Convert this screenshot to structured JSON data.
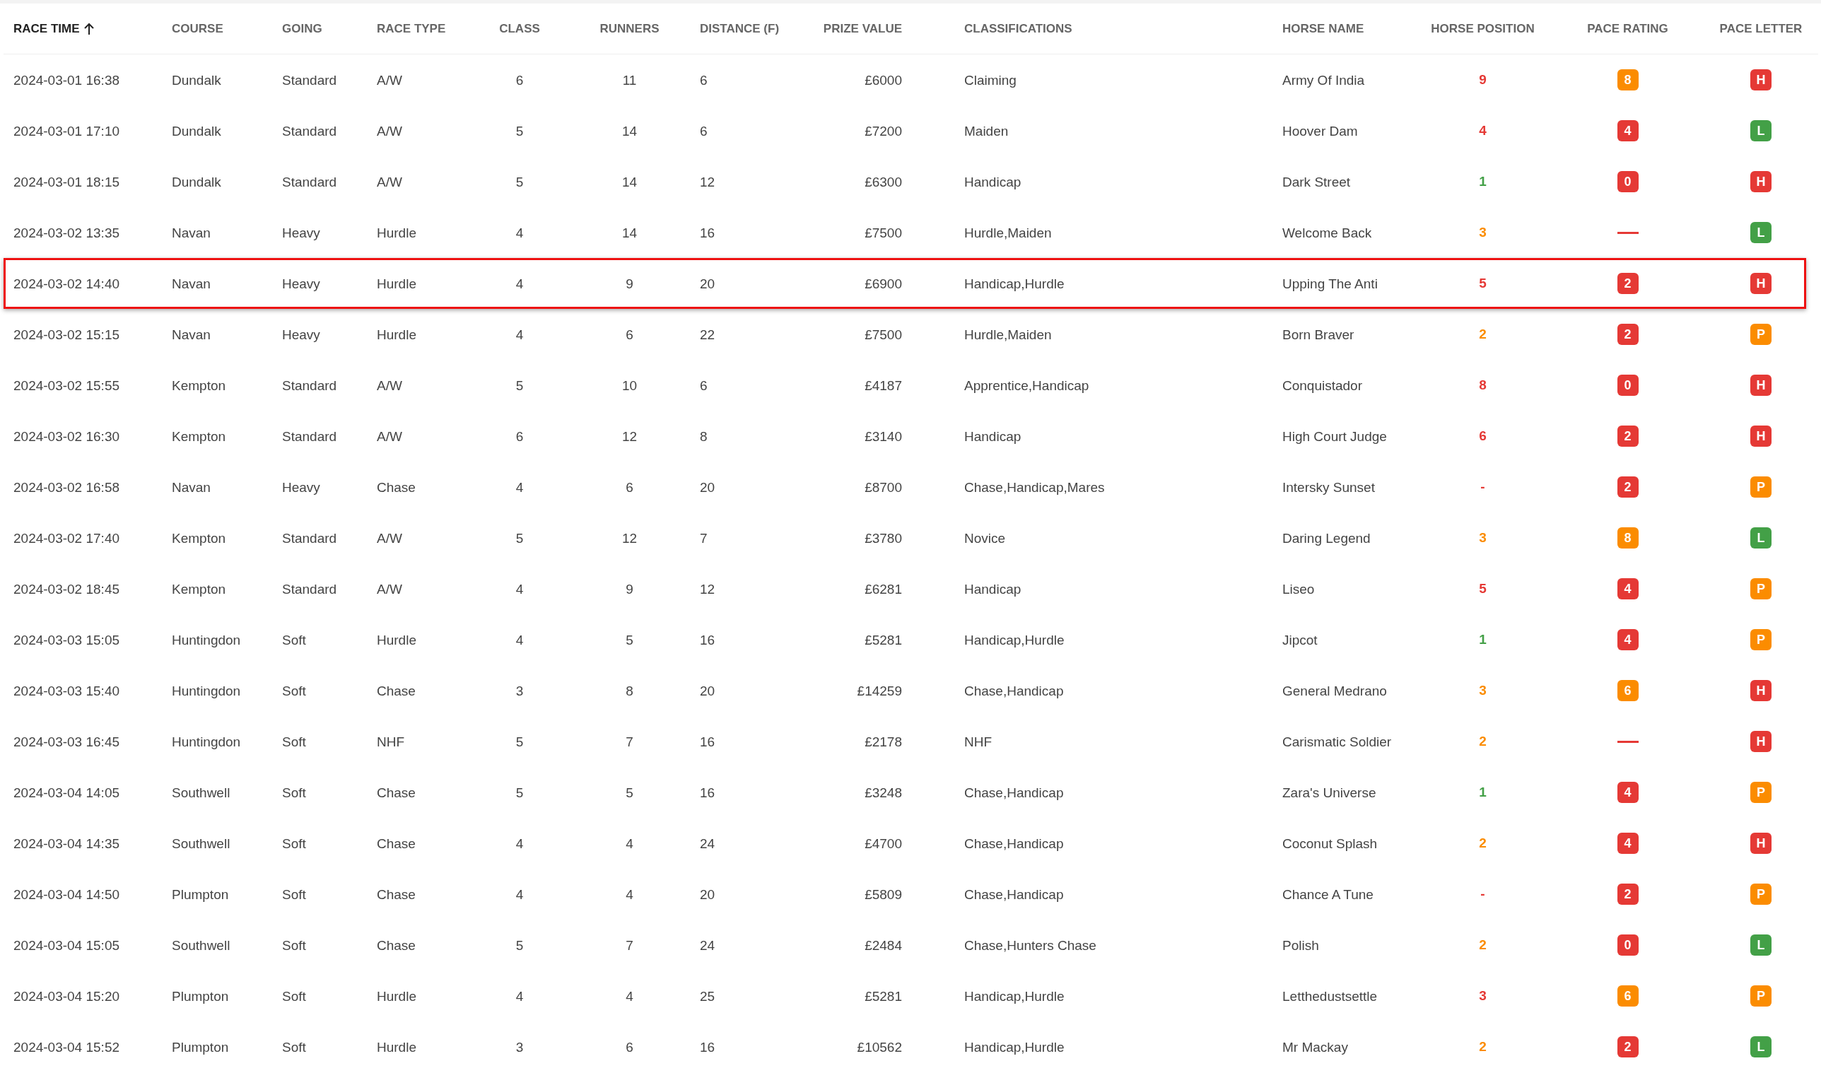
{
  "table": {
    "columns": [
      {
        "label": "RACE TIME",
        "sorted": true,
        "ascending": true
      },
      {
        "label": "COURSE"
      },
      {
        "label": "GOING"
      },
      {
        "label": "RACE TYPE"
      },
      {
        "label": "CLASS"
      },
      {
        "label": "RUNNERS"
      },
      {
        "label": "DISTANCE (F)"
      },
      {
        "label": "PRIZE VALUE"
      },
      {
        "label": "CLASSIFICATIONS"
      },
      {
        "label": "HORSE NAME"
      },
      {
        "label": "HORSE POSITION"
      },
      {
        "label": "PACE RATING"
      },
      {
        "label": "PACE LETTER"
      }
    ],
    "rows": [
      {
        "selected": false,
        "cells": [
          "2024-03-01 16:38",
          "Dundalk",
          "Standard",
          "A/W",
          "6",
          "11",
          "6",
          "£6000",
          "Claiming",
          "Army Of India"
        ],
        "position": {
          "text": "9",
          "color": "#e53935"
        },
        "pace_rating": {
          "kind": "badge",
          "text": "8",
          "color": "#fb8c00"
        },
        "pace_letter": {
          "text": "H",
          "color": "#e53935"
        }
      },
      {
        "selected": false,
        "cells": [
          "2024-03-01 17:10",
          "Dundalk",
          "Standard",
          "A/W",
          "5",
          "14",
          "6",
          "£7200",
          "Maiden",
          "Hoover Dam"
        ],
        "position": {
          "text": "4",
          "color": "#e53935"
        },
        "pace_rating": {
          "kind": "badge",
          "text": "4",
          "color": "#e53935"
        },
        "pace_letter": {
          "text": "L",
          "color": "#43a047"
        }
      },
      {
        "selected": false,
        "cells": [
          "2024-03-01 18:15",
          "Dundalk",
          "Standard",
          "A/W",
          "5",
          "14",
          "12",
          "£6300",
          "Handicap",
          "Dark Street"
        ],
        "position": {
          "text": "1",
          "color": "#43a047"
        },
        "pace_rating": {
          "kind": "badge",
          "text": "0",
          "color": "#e53935"
        },
        "pace_letter": {
          "text": "H",
          "color": "#e53935"
        }
      },
      {
        "selected": false,
        "cells": [
          "2024-03-02 13:35",
          "Navan",
          "Heavy",
          "Hurdle",
          "4",
          "14",
          "16",
          "£7500",
          "Hurdle,Maiden",
          "Welcome Back"
        ],
        "position": {
          "text": "3",
          "color": "#fb8c00"
        },
        "pace_rating": {
          "kind": "dash",
          "color": "#e53935"
        },
        "pace_letter": {
          "text": "L",
          "color": "#43a047"
        }
      },
      {
        "selected": true,
        "cells": [
          "2024-03-02 14:40",
          "Navan",
          "Heavy",
          "Hurdle",
          "4",
          "9",
          "20",
          "£6900",
          "Handicap,Hurdle",
          "Upping The Anti"
        ],
        "position": {
          "text": "5",
          "color": "#e53935"
        },
        "pace_rating": {
          "kind": "badge",
          "text": "2",
          "color": "#e53935"
        },
        "pace_letter": {
          "text": "H",
          "color": "#e53935"
        }
      },
      {
        "selected": false,
        "cells": [
          "2024-03-02 15:15",
          "Navan",
          "Heavy",
          "Hurdle",
          "4",
          "6",
          "22",
          "£7500",
          "Hurdle,Maiden",
          "Born Braver"
        ],
        "position": {
          "text": "2",
          "color": "#fb8c00"
        },
        "pace_rating": {
          "kind": "badge",
          "text": "2",
          "color": "#e53935"
        },
        "pace_letter": {
          "text": "P",
          "color": "#fb8c00"
        }
      },
      {
        "selected": false,
        "cells": [
          "2024-03-02 15:55",
          "Kempton",
          "Standard",
          "A/W",
          "5",
          "10",
          "6",
          "£4187",
          "Apprentice,Handicap",
          "Conquistador"
        ],
        "position": {
          "text": "8",
          "color": "#e53935"
        },
        "pace_rating": {
          "kind": "badge",
          "text": "0",
          "color": "#e53935"
        },
        "pace_letter": {
          "text": "H",
          "color": "#e53935"
        }
      },
      {
        "selected": false,
        "cells": [
          "2024-03-02 16:30",
          "Kempton",
          "Standard",
          "A/W",
          "6",
          "12",
          "8",
          "£3140",
          "Handicap",
          "High Court Judge"
        ],
        "position": {
          "text": "6",
          "color": "#e53935"
        },
        "pace_rating": {
          "kind": "badge",
          "text": "2",
          "color": "#e53935"
        },
        "pace_letter": {
          "text": "H",
          "color": "#e53935"
        }
      },
      {
        "selected": false,
        "cells": [
          "2024-03-02 16:58",
          "Navan",
          "Heavy",
          "Chase",
          "4",
          "6",
          "20",
          "£8700",
          "Chase,Handicap,Mares",
          "Intersky Sunset"
        ],
        "position": {
          "text": "-",
          "color": "#e53935"
        },
        "pace_rating": {
          "kind": "badge",
          "text": "2",
          "color": "#e53935"
        },
        "pace_letter": {
          "text": "P",
          "color": "#fb8c00"
        }
      },
      {
        "selected": false,
        "cells": [
          "2024-03-02 17:40",
          "Kempton",
          "Standard",
          "A/W",
          "5",
          "12",
          "7",
          "£3780",
          "Novice",
          "Daring Legend"
        ],
        "position": {
          "text": "3",
          "color": "#fb8c00"
        },
        "pace_rating": {
          "kind": "badge",
          "text": "8",
          "color": "#fb8c00"
        },
        "pace_letter": {
          "text": "L",
          "color": "#43a047"
        }
      },
      {
        "selected": false,
        "cells": [
          "2024-03-02 18:45",
          "Kempton",
          "Standard",
          "A/W",
          "4",
          "9",
          "12",
          "£6281",
          "Handicap",
          "Liseo"
        ],
        "position": {
          "text": "5",
          "color": "#e53935"
        },
        "pace_rating": {
          "kind": "badge",
          "text": "4",
          "color": "#e53935"
        },
        "pace_letter": {
          "text": "P",
          "color": "#fb8c00"
        }
      },
      {
        "selected": false,
        "cells": [
          "2024-03-03 15:05",
          "Huntingdon",
          "Soft",
          "Hurdle",
          "4",
          "5",
          "16",
          "£5281",
          "Handicap,Hurdle",
          "Jipcot"
        ],
        "position": {
          "text": "1",
          "color": "#43a047"
        },
        "pace_rating": {
          "kind": "badge",
          "text": "4",
          "color": "#e53935"
        },
        "pace_letter": {
          "text": "P",
          "color": "#fb8c00"
        }
      },
      {
        "selected": false,
        "cells": [
          "2024-03-03 15:40",
          "Huntingdon",
          "Soft",
          "Chase",
          "3",
          "8",
          "20",
          "£14259",
          "Chase,Handicap",
          "General Medrano"
        ],
        "position": {
          "text": "3",
          "color": "#fb8c00"
        },
        "pace_rating": {
          "kind": "badge",
          "text": "6",
          "color": "#fb8c00"
        },
        "pace_letter": {
          "text": "H",
          "color": "#e53935"
        }
      },
      {
        "selected": false,
        "cells": [
          "2024-03-03 16:45",
          "Huntingdon",
          "Soft",
          "NHF",
          "5",
          "7",
          "16",
          "£2178",
          "NHF",
          "Carismatic Soldier"
        ],
        "position": {
          "text": "2",
          "color": "#fb8c00"
        },
        "pace_rating": {
          "kind": "dash",
          "color": "#e53935"
        },
        "pace_letter": {
          "text": "H",
          "color": "#e53935"
        }
      },
      {
        "selected": false,
        "cells": [
          "2024-03-04 14:05",
          "Southwell",
          "Soft",
          "Chase",
          "5",
          "5",
          "16",
          "£3248",
          "Chase,Handicap",
          "Zara's Universe"
        ],
        "position": {
          "text": "1",
          "color": "#43a047"
        },
        "pace_rating": {
          "kind": "badge",
          "text": "4",
          "color": "#e53935"
        },
        "pace_letter": {
          "text": "P",
          "color": "#fb8c00"
        }
      },
      {
        "selected": false,
        "cells": [
          "2024-03-04 14:35",
          "Southwell",
          "Soft",
          "Chase",
          "4",
          "4",
          "24",
          "£4700",
          "Chase,Handicap",
          "Coconut Splash"
        ],
        "position": {
          "text": "2",
          "color": "#fb8c00"
        },
        "pace_rating": {
          "kind": "badge",
          "text": "4",
          "color": "#e53935"
        },
        "pace_letter": {
          "text": "H",
          "color": "#e53935"
        }
      },
      {
        "selected": false,
        "cells": [
          "2024-03-04 14:50",
          "Plumpton",
          "Soft",
          "Chase",
          "4",
          "4",
          "20",
          "£5809",
          "Chase,Handicap",
          "Chance A Tune"
        ],
        "position": {
          "text": "-",
          "color": "#e53935"
        },
        "pace_rating": {
          "kind": "badge",
          "text": "2",
          "color": "#e53935"
        },
        "pace_letter": {
          "text": "P",
          "color": "#fb8c00"
        }
      },
      {
        "selected": false,
        "cells": [
          "2024-03-04 15:05",
          "Southwell",
          "Soft",
          "Chase",
          "5",
          "7",
          "24",
          "£2484",
          "Chase,Hunters Chase",
          "Polish"
        ],
        "position": {
          "text": "2",
          "color": "#fb8c00"
        },
        "pace_rating": {
          "kind": "badge",
          "text": "0",
          "color": "#e53935"
        },
        "pace_letter": {
          "text": "L",
          "color": "#43a047"
        }
      },
      {
        "selected": false,
        "cells": [
          "2024-03-04 15:20",
          "Plumpton",
          "Soft",
          "Hurdle",
          "4",
          "4",
          "25",
          "£5281",
          "Handicap,Hurdle",
          "Letthedustsettle"
        ],
        "position": {
          "text": "3",
          "color": "#e53935"
        },
        "pace_rating": {
          "kind": "badge",
          "text": "6",
          "color": "#fb8c00"
        },
        "pace_letter": {
          "text": "P",
          "color": "#fb8c00"
        }
      },
      {
        "selected": false,
        "cells": [
          "2024-03-04 15:52",
          "Plumpton",
          "Soft",
          "Hurdle",
          "3",
          "6",
          "16",
          "£10562",
          "Handicap,Hurdle",
          "Mr Mackay"
        ],
        "position": {
          "text": "2",
          "color": "#fb8c00"
        },
        "pace_rating": {
          "kind": "badge",
          "text": "2",
          "color": "#e53935"
        },
        "pace_letter": {
          "text": "L",
          "color": "#43a047"
        }
      }
    ]
  }
}
